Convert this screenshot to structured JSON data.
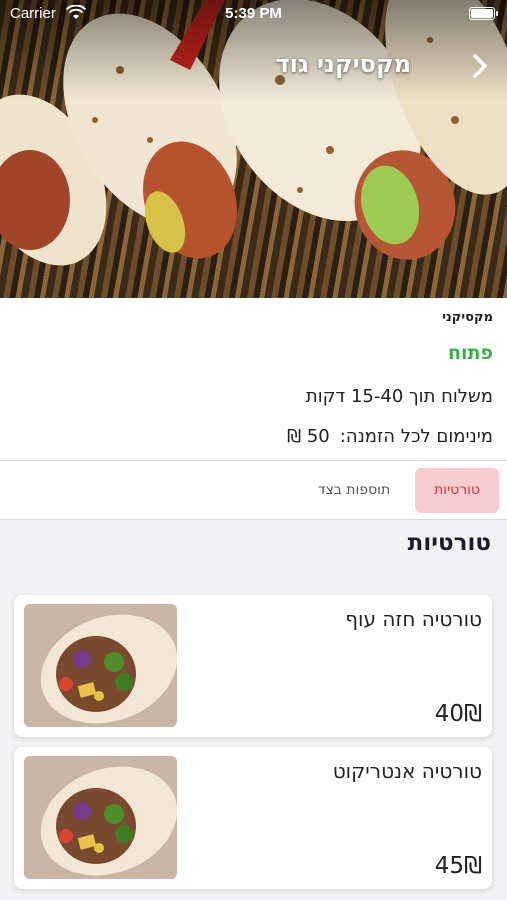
{
  "status_bar": {
    "carrier": "Carrier",
    "time": "5:39 PM"
  },
  "header": {
    "title": "מקסיקני גוד"
  },
  "restaurant": {
    "cuisine": "מקסיקני",
    "status": "פתוח",
    "delivery_time": "משלוח תוך 15-40 דקות",
    "minimum_label": "מינימום לכל הזמנה:",
    "minimum_value": "50 ₪"
  },
  "tabs": [
    {
      "label": "טורטיות",
      "active": true
    },
    {
      "label": "תוספות בצד",
      "active": false
    }
  ],
  "section": {
    "title": "טורטיות"
  },
  "items": [
    {
      "name": "טורטיה חזה עוף",
      "price": "40₪"
    },
    {
      "name": "טורטיה אנטריקוט",
      "price": "45₪"
    }
  ],
  "colors": {
    "open_green": "#3fae49",
    "tab_active_bg": "#f7cdd0",
    "tab_active_text": "#d8333e"
  },
  "icons": {
    "back": "chevron-right-icon",
    "wifi": "wifi-icon",
    "battery": "battery-icon"
  }
}
